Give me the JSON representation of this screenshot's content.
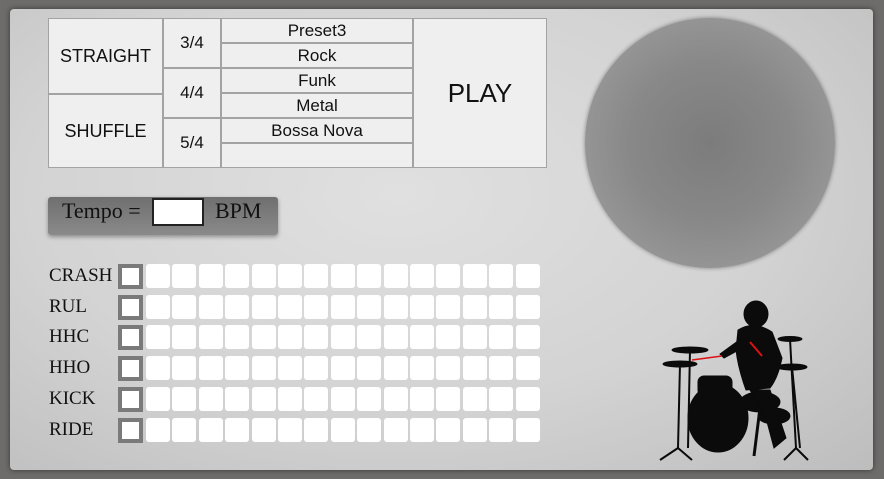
{
  "styles": [
    {
      "id": "straight",
      "label": "STRAIGHT"
    },
    {
      "id": "shuffle",
      "label": "SHUFFLE"
    }
  ],
  "time_signatures": [
    {
      "id": "3-4",
      "label": "3/4"
    },
    {
      "id": "4-4",
      "label": "4/4"
    },
    {
      "id": "5-4",
      "label": "5/4"
    }
  ],
  "presets": [
    {
      "id": "preset3",
      "label": "Preset3"
    },
    {
      "id": "rock",
      "label": "Rock"
    },
    {
      "id": "funk",
      "label": "Funk"
    },
    {
      "id": "metal",
      "label": "Metal"
    },
    {
      "id": "bossa-nova",
      "label": "Bossa Nova"
    },
    {
      "id": "empty",
      "label": ""
    }
  ],
  "play": {
    "label": "PLAY"
  },
  "tempo": {
    "prefix": "Tempo =",
    "value": "",
    "suffix": "BPM"
  },
  "sequencer": {
    "steps": 15,
    "tracks": [
      {
        "label": "CRASH"
      },
      {
        "label": "RUL"
      },
      {
        "label": "HHC"
      },
      {
        "label": "HHO"
      },
      {
        "label": "KICK"
      },
      {
        "label": "RIDE"
      }
    ]
  },
  "icons": {
    "drummer": "drummer-silhouette-icon"
  }
}
